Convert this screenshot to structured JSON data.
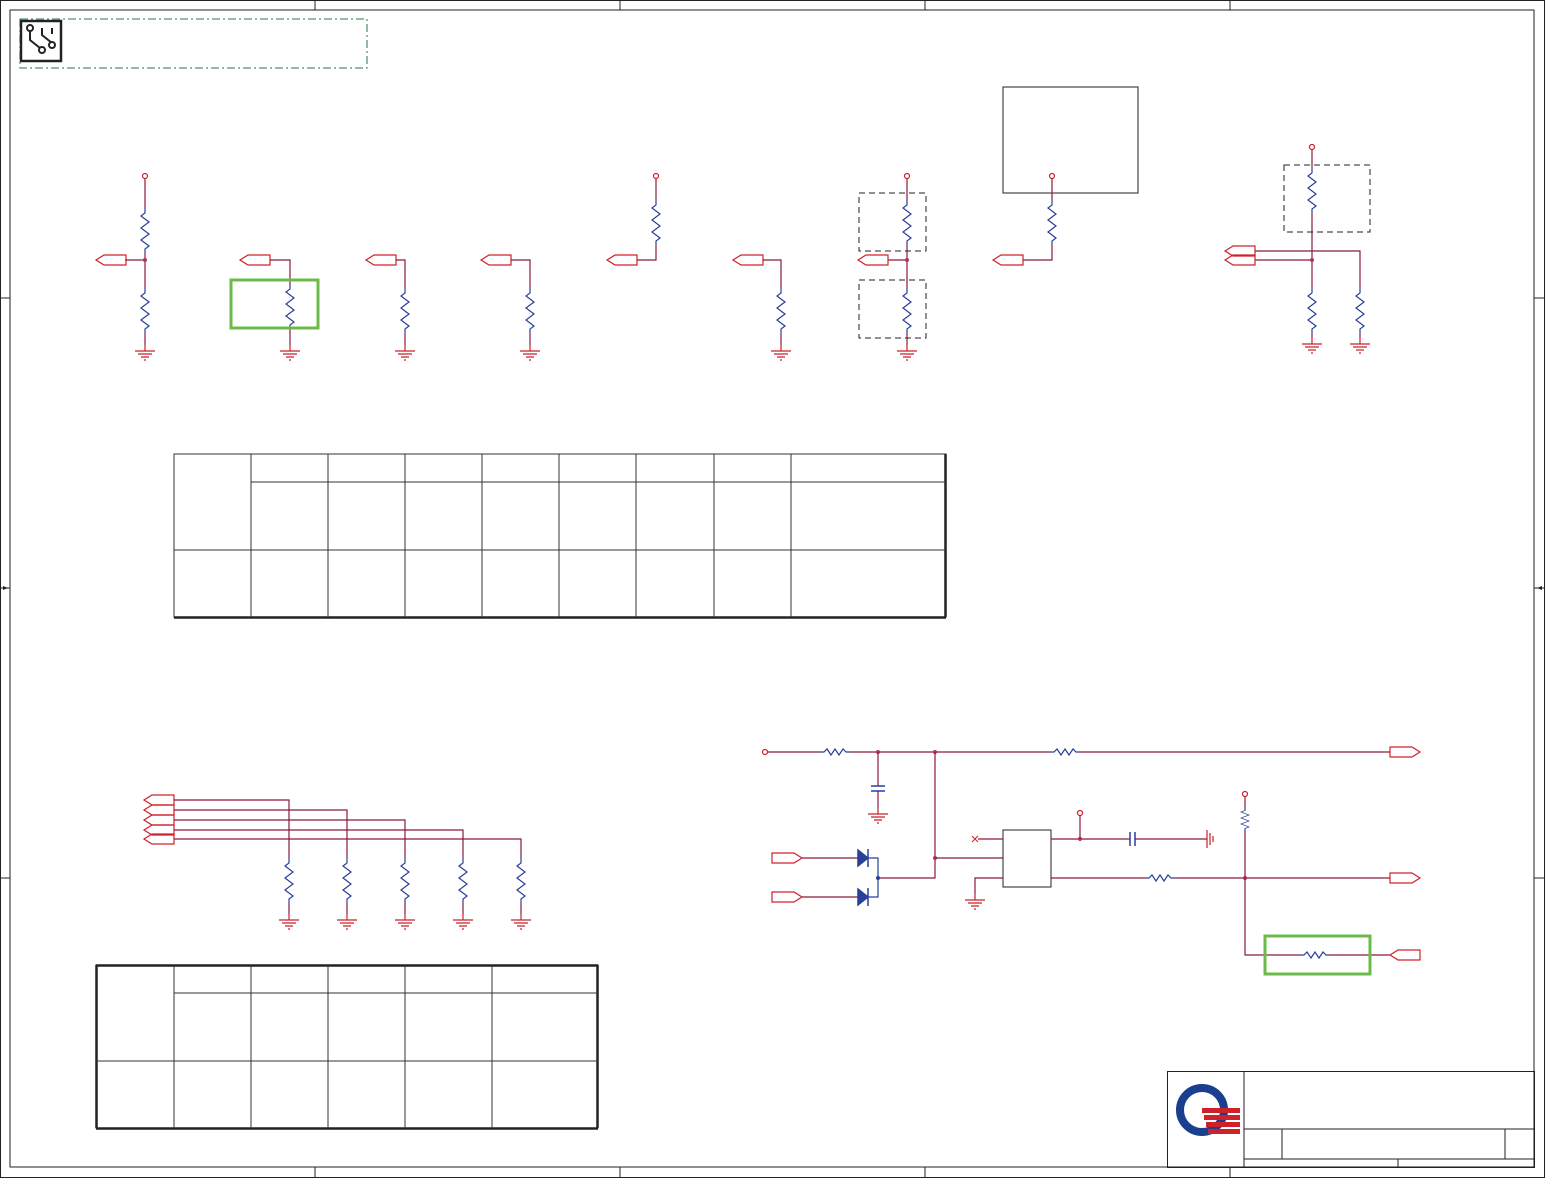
{
  "colors": {
    "wire": "#8b1a3a",
    "resistor": "#2a3f9a",
    "ground": "#c8202a",
    "port": "#d0202a",
    "highlight": "#6cbb4a",
    "logo_blue": "#1b3f8f",
    "logo_red": "#d0202a"
  },
  "header": {
    "icon": "circuit-board-icon"
  },
  "title_block": {
    "logo": "company-logo-icon"
  }
}
